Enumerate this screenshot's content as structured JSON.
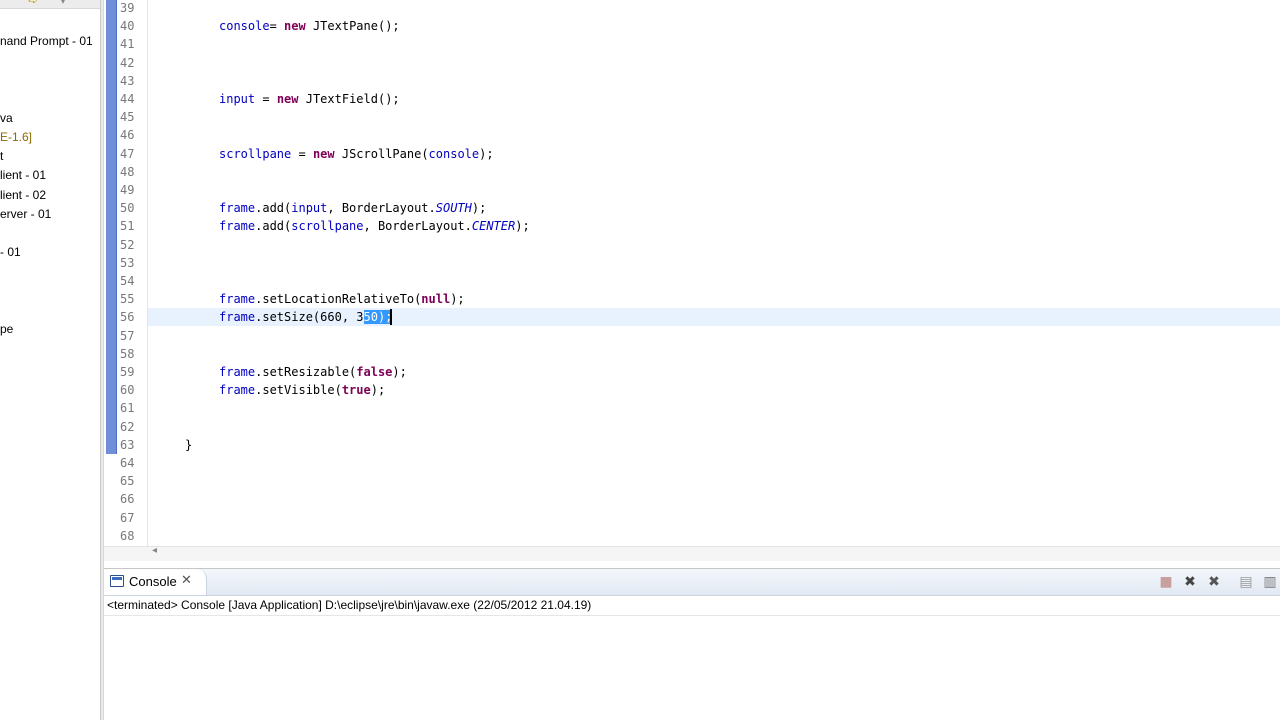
{
  "explorer": {
    "items": [
      "nand Prompt - 01",
      "va",
      "E-1.6]",
      "t",
      "lient - 01",
      "lient - 02",
      "erver - 01",
      "- 01",
      "pe"
    ],
    "toolbar_icons": [
      "forward-icon",
      "view-menu-icon"
    ]
  },
  "editor": {
    "lines": [
      {
        "n": "39",
        "code": []
      },
      {
        "n": "40",
        "code": [
          [
            "fld",
            "console"
          ],
          [
            "",
            "= "
          ],
          [
            "kw",
            "new"
          ],
          [
            "",
            " JTextPane();"
          ]
        ]
      },
      {
        "n": "41",
        "code": []
      },
      {
        "n": "42",
        "code": []
      },
      {
        "n": "43",
        "code": []
      },
      {
        "n": "44",
        "code": [
          [
            "fld",
            "input"
          ],
          [
            "",
            " = "
          ],
          [
            "kw",
            "new"
          ],
          [
            "",
            " JTextField();"
          ]
        ]
      },
      {
        "n": "45",
        "code": []
      },
      {
        "n": "46",
        "code": []
      },
      {
        "n": "47",
        "code": [
          [
            "fld",
            "scrollpane"
          ],
          [
            "",
            " = "
          ],
          [
            "kw",
            "new"
          ],
          [
            "",
            " JScrollPane("
          ],
          [
            "fld",
            "console"
          ],
          [
            "",
            ");"
          ]
        ]
      },
      {
        "n": "48",
        "code": []
      },
      {
        "n": "49",
        "code": []
      },
      {
        "n": "50",
        "code": [
          [
            "fld",
            "frame"
          ],
          [
            "",
            ".add("
          ],
          [
            "fld",
            "input"
          ],
          [
            "",
            ", BorderLayout."
          ],
          [
            "stat",
            "SOUTH"
          ],
          [
            "",
            ");"
          ]
        ]
      },
      {
        "n": "51",
        "code": [
          [
            "fld",
            "frame"
          ],
          [
            "",
            ".add("
          ],
          [
            "fld",
            "scrollpane"
          ],
          [
            "",
            ", BorderLayout."
          ],
          [
            "stat",
            "CENTER"
          ],
          [
            "",
            ");"
          ]
        ]
      },
      {
        "n": "52",
        "code": []
      },
      {
        "n": "53",
        "code": []
      },
      {
        "n": "54",
        "code": []
      },
      {
        "n": "55",
        "code": [
          [
            "fld",
            "frame"
          ],
          [
            "",
            ".setLocationRelativeTo("
          ],
          [
            "kw",
            "null"
          ],
          [
            "",
            ");"
          ]
        ]
      },
      {
        "n": "56",
        "code": [
          [
            "fld",
            "frame"
          ],
          [
            "",
            ".setSize(660, 3"
          ],
          [
            "sel",
            "50);"
          ]
        ],
        "current": true
      },
      {
        "n": "57",
        "code": []
      },
      {
        "n": "58",
        "code": []
      },
      {
        "n": "59",
        "code": [
          [
            "fld",
            "frame"
          ],
          [
            "",
            ".setResizable("
          ],
          [
            "kw",
            "false"
          ],
          [
            "",
            ");"
          ]
        ]
      },
      {
        "n": "60",
        "code": [
          [
            "fld",
            "frame"
          ],
          [
            "",
            ".setVisible("
          ],
          [
            "kw",
            "true"
          ],
          [
            "",
            ");"
          ]
        ]
      },
      {
        "n": "61",
        "code": []
      },
      {
        "n": "62",
        "code": []
      },
      {
        "n": "63",
        "code": [
          [
            "",
            "}"
          ]
        ],
        "indent": "brace"
      },
      {
        "n": "64",
        "code": []
      },
      {
        "n": "65",
        "code": []
      },
      {
        "n": "66",
        "code": []
      },
      {
        "n": "67",
        "code": []
      },
      {
        "n": "68",
        "code": []
      }
    ]
  },
  "console": {
    "tab_label": "Console",
    "status": "<terminated> Console [Java Application] D:\\eclipse\\jre\\bin\\javaw.exe (22/05/2012 21.04.19)",
    "tools": [
      "terminate-icon",
      "remove-launch-icon",
      "remove-all-launches-icon",
      "clear-console-icon",
      "scroll-lock-icon"
    ]
  }
}
